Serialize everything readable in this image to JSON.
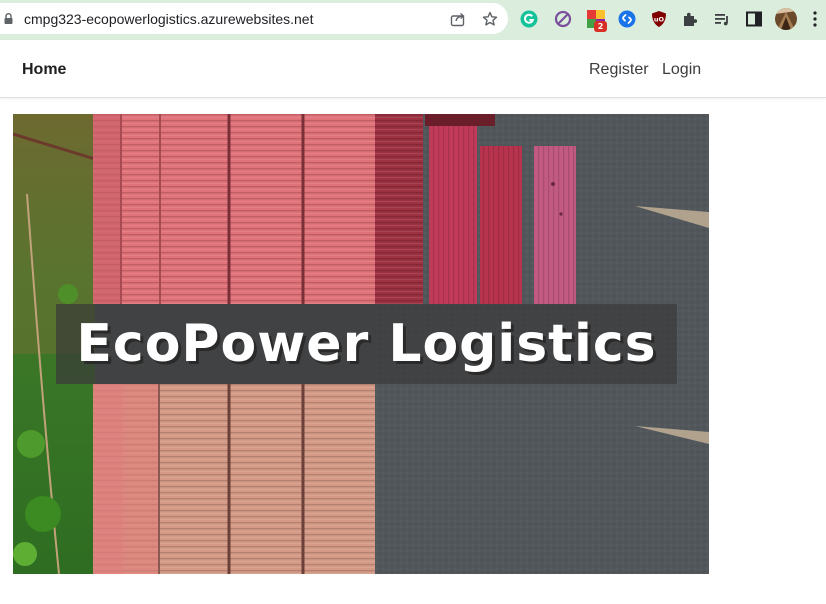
{
  "browser": {
    "url": "cmpg323-ecopowerlogistics.azurewebsites.net",
    "extension_badge": "2"
  },
  "nav": {
    "home": "Home",
    "register": "Register",
    "login": "Login"
  },
  "hero": {
    "title": "EcoPower Logistics"
  }
}
